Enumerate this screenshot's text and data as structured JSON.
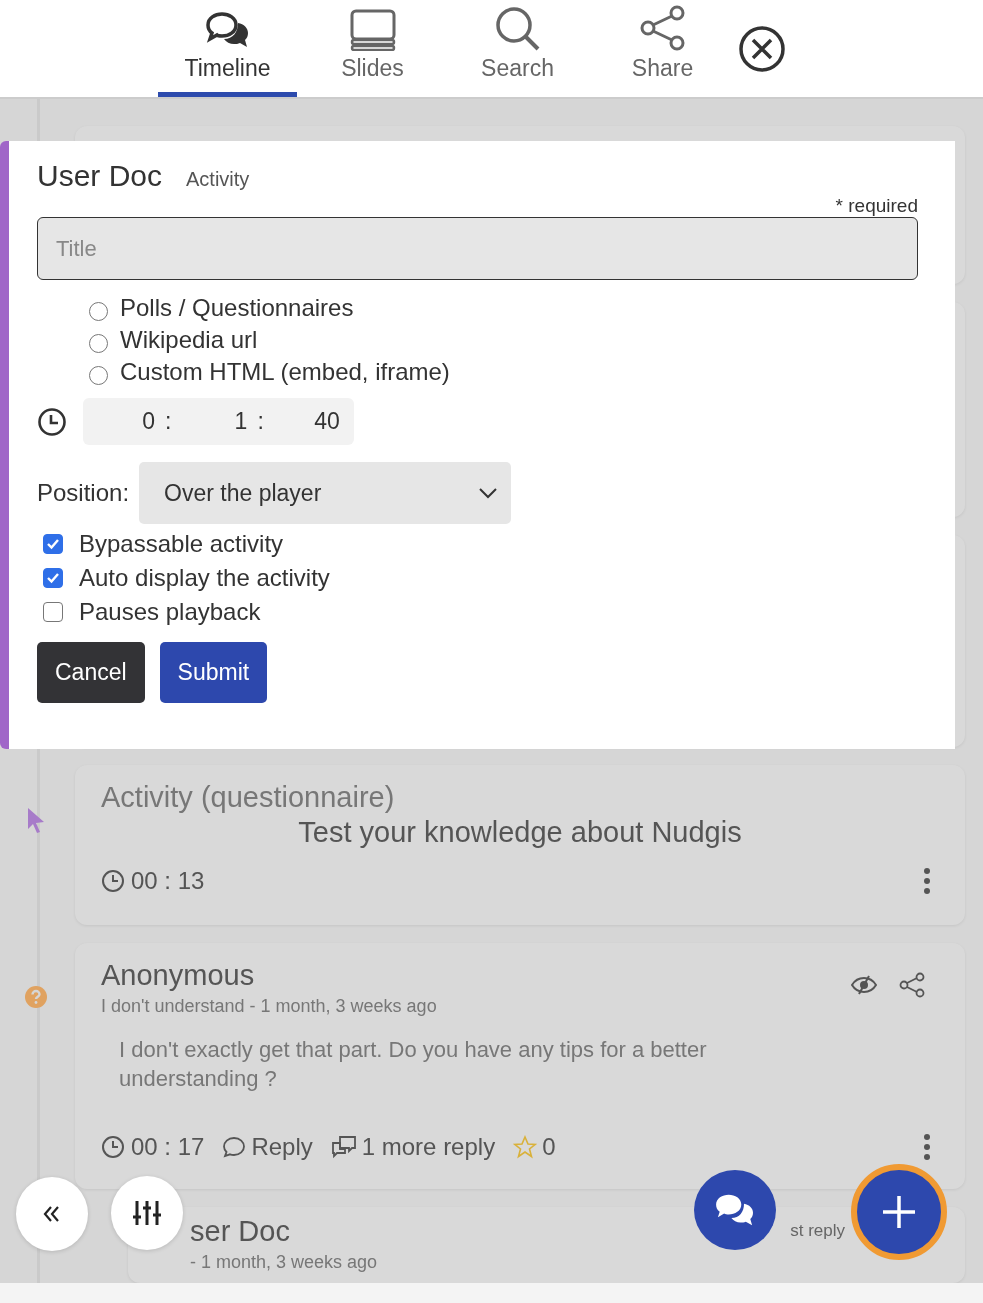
{
  "nav": {
    "tabs": [
      {
        "label": "Timeline",
        "selected": true
      },
      {
        "label": "Slides",
        "selected": false
      },
      {
        "label": "Search",
        "selected": false
      },
      {
        "label": "Share",
        "selected": false
      }
    ]
  },
  "modal": {
    "title": "User Doc",
    "subtitle": "Activity",
    "required_note": "* required",
    "title_field": {
      "placeholder": "Title"
    },
    "activity_types": [
      {
        "label": "Polls / Questionnaires",
        "selected": false
      },
      {
        "label": "Wikipedia url",
        "selected": false
      },
      {
        "label": "Custom HTML (embed, iframe)",
        "selected": false
      }
    ],
    "time_fields": [
      {
        "value": "0",
        "separator": ":"
      },
      {
        "value": "1",
        "separator": ":"
      },
      {
        "value": "40"
      }
    ],
    "position": {
      "label": "Position:",
      "value": "Over the player"
    },
    "options": [
      {
        "label": "Bypassable activity",
        "checked": true
      },
      {
        "label": "Auto display the activity",
        "checked": true
      },
      {
        "label": "Pauses playback",
        "checked": false
      }
    ],
    "buttons": [
      {
        "label": "Cancel",
        "kind": "secondary"
      },
      {
        "label": "Submit",
        "kind": "primary"
      }
    ]
  },
  "timeline": {
    "cards": [
      {
        "kind": "hidden"
      },
      {
        "kind": "hidden"
      },
      {
        "kind": "hidden"
      },
      {
        "kind": "activity",
        "heading": "Activity (questionnaire)",
        "title": "Test your knowledge about Nudgis",
        "time": "00 : 13"
      },
      {
        "kind": "comment",
        "author": "Anonymous",
        "meta": "I don't understand - 1 month, 3 weeks ago",
        "body": "I don't exactly get that part. Do you have any tips for a better understanding ?",
        "time": "00 : 17",
        "reply": "Reply",
        "more_replies": "1 more reply",
        "likes": "0"
      },
      {
        "kind": "reply",
        "author": "ser Doc",
        "meta": "- 1 month, 3 weeks ago",
        "last_reply": "st reply"
      }
    ]
  }
}
